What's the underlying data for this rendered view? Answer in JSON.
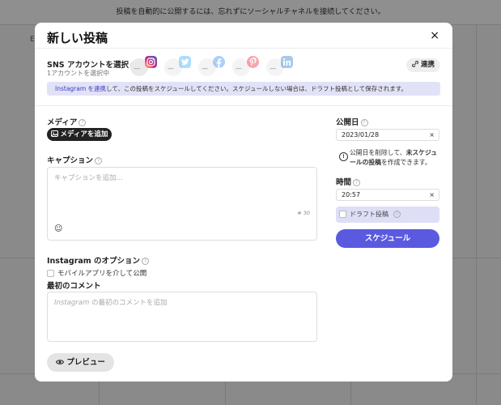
{
  "background": {
    "banner_text": "投稿を自動的に公開するには、忘れずにソーシャルチャネルを接続してください。",
    "letter": "E"
  },
  "modal": {
    "title": "新しい投稿",
    "close_icon": "×",
    "sns": {
      "label": "SNS アカウントを選択",
      "sub": "1アカウントを選択中",
      "accounts": [
        {
          "name": "instagram",
          "selected": true,
          "color": "#d62976"
        },
        {
          "name": "twitter",
          "selected": false,
          "color": "#1da1f2"
        },
        {
          "name": "facebook",
          "selected": false,
          "color": "#1877f2"
        },
        {
          "name": "pinterest",
          "selected": false,
          "color": "#e60023"
        },
        {
          "name": "linkedin",
          "selected": false,
          "color": "#0a66c2"
        }
      ],
      "connect_label": "連携"
    },
    "info_banner": {
      "link": "Instagram を連携",
      "text": "して、この投稿をスケジュールしてください。スケジュールしない場合は、ドラフト投稿として保存されます。"
    },
    "media": {
      "label": "メディア",
      "add_button": "メディアを追加"
    },
    "caption": {
      "label": "キャプション",
      "placeholder": "キャプションを追加...",
      "char_count": "# 30"
    },
    "instagram_options": {
      "label": "Instagram のオプション",
      "mobile_publish": "モバイルアプリを介して公開"
    },
    "first_comment": {
      "label": "最初のコメント",
      "placeholder_prefix": "Instagram",
      "placeholder_suffix": " の最初のコメントを追加"
    },
    "preview_button": "プレビュー",
    "publish_date": {
      "label": "公開日",
      "value": "2023/01/28",
      "clear": "×"
    },
    "note": {
      "pre": "公開日を削除して、",
      "bold": "未スケジュールの投稿",
      "post": "を作成できます。"
    },
    "time": {
      "label": "時間",
      "value": "20:57",
      "clear": "×"
    },
    "draft_label": "ドラフト投稿",
    "schedule_button": "スケジュール"
  }
}
